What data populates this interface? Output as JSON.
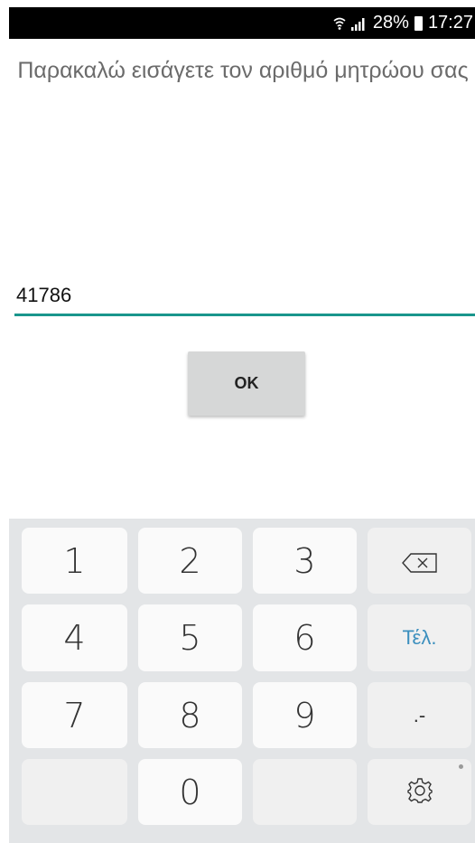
{
  "status_bar": {
    "battery_percent": "28%",
    "time": "17:27",
    "icons": [
      "wifi-icon",
      "signal-icon",
      "battery-icon"
    ]
  },
  "prompt_text": "Παρακαλώ εισάγετε τον αριθμό μητρώου σας",
  "input": {
    "value": "41786"
  },
  "ok_button": {
    "label": "OK"
  },
  "keyboard": {
    "keys": {
      "k1": "1",
      "k2": "2",
      "k3": "3",
      "k4": "4",
      "k5": "5",
      "k6": "6",
      "k7": "7",
      "k8": "8",
      "k9": "9",
      "k0": "0",
      "done": "Τέλ.",
      "punct": ".-"
    },
    "icons": [
      "backspace-icon",
      "settings-icon"
    ]
  },
  "colors": {
    "accent_underline": "#1a968c",
    "done_key": "#3c8fbe",
    "button_bg": "#d6d7d7",
    "keyboard_bg": "#e3e5e7"
  }
}
